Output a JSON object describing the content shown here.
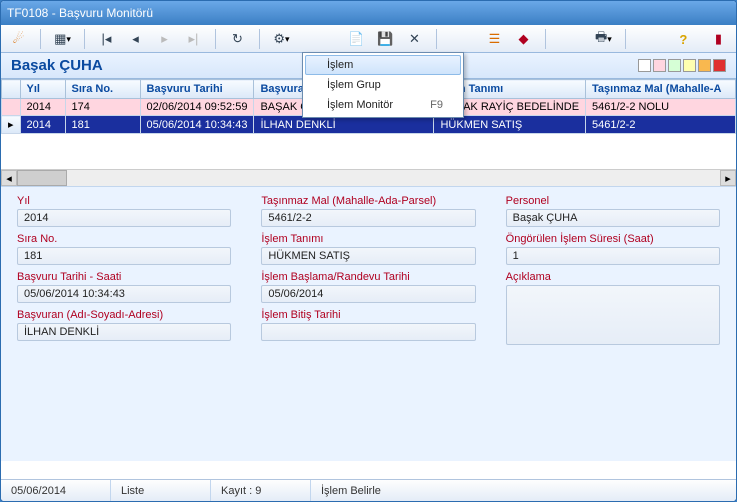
{
  "window": {
    "title": "TF0108 - Başvuru Monitörü"
  },
  "user": {
    "name": "Başak ÇUHA"
  },
  "menu": {
    "items": [
      {
        "label": "İşlem",
        "key": ""
      },
      {
        "label": "İşlem Grup",
        "key": ""
      },
      {
        "label": "İşlem Monitör",
        "key": "F9"
      }
    ]
  },
  "grid": {
    "headers": [
      "Yıl",
      "Sıra No.",
      "Başvuru Tarihi",
      "Başvura",
      "şlem Tanımı",
      "Taşınmaz Mal (Mahalle-A"
    ],
    "rows": [
      {
        "rowmark": "",
        "cells": [
          "2014",
          "174",
          "02/06/2014 09:52:59",
          "BAŞAK ÇUHA",
          "EMLAK RAYİÇ BEDELİNDE",
          "5461/2-2 NOLU"
        ]
      },
      {
        "rowmark": "▸",
        "cells": [
          "2014",
          "181",
          "05/06/2014 10:34:43",
          "İLHAN DENKLİ",
          "HÜKMEN SATIŞ",
          "5461/2-2"
        ]
      }
    ]
  },
  "form": {
    "yil": {
      "label": "Yıl",
      "value": "2014"
    },
    "sira": {
      "label": "Sıra No.",
      "value": "181"
    },
    "basvuru_tarihi": {
      "label": "Başvuru Tarihi - Saati",
      "value": "05/06/2014 10:34:43"
    },
    "basvuran": {
      "label": "Başvuran (Adı-Soyadı-Adresi)",
      "value": "İLHAN DENKLİ"
    },
    "tasinmaz": {
      "label": "Taşınmaz Mal (Mahalle-Ada-Parsel)",
      "value": "5461/2-2"
    },
    "islem_tanimi": {
      "label": "İşlem Tanımı",
      "value": "HÜKMEN SATIŞ"
    },
    "islem_baslama": {
      "label": "İşlem Başlama/Randevu Tarihi",
      "value": "05/06/2014"
    },
    "islem_bitis": {
      "label": "İşlem Bitiş Tarihi",
      "value": ""
    },
    "personel": {
      "label": "Personel",
      "value": "Başak ÇUHA"
    },
    "sure": {
      "label": "Öngörülen İşlem Süresi (Saat)",
      "value": "1"
    },
    "aciklama": {
      "label": "Açıklama",
      "value": ""
    }
  },
  "status": {
    "date": "05/06/2014",
    "mode": "Liste",
    "count_label": "Kayıt : 9",
    "action": "İşlem Belirle"
  }
}
